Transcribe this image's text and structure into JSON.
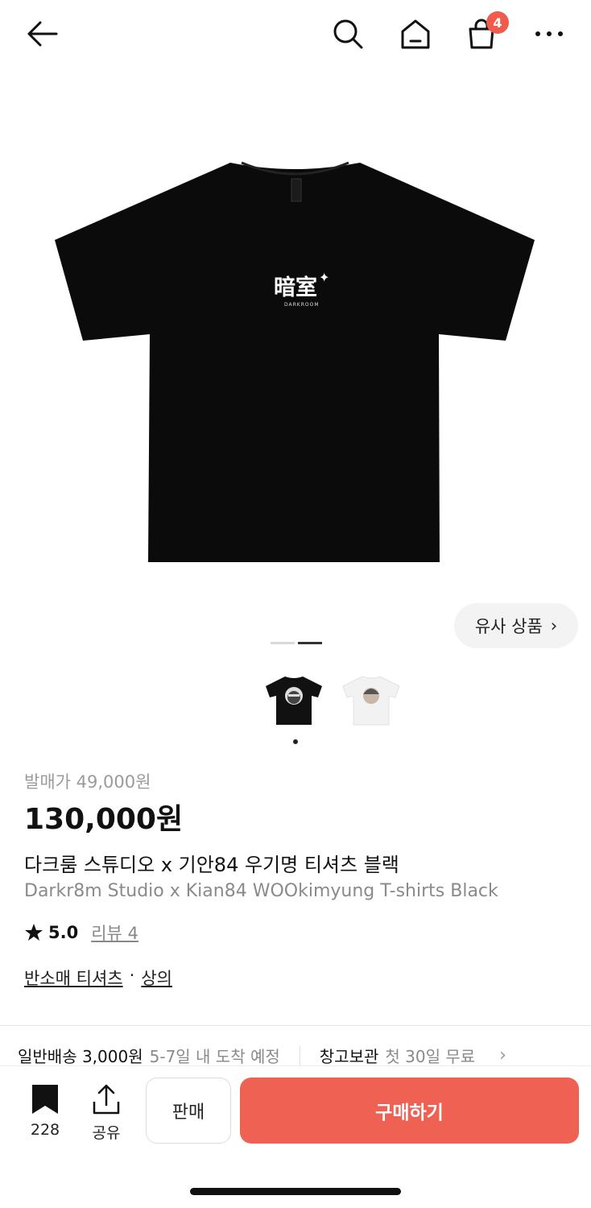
{
  "topbar": {
    "cart_count": "4"
  },
  "hero": {
    "print_hanja": "暗室",
    "print_brand": "DARKROOM"
  },
  "similar": {
    "label": "유사 상품",
    "chevron": "›"
  },
  "product": {
    "orig_price": "발매가 49,000원",
    "price": "130,000원",
    "title_ko": "다크룸 스튜디오 x 기안84 우기명 티셔츠 블랙",
    "title_en": "Darkr8m Studio x Kian84 WOOkimyung T-shirts Black",
    "rating": "5.0",
    "review": "리뷰 4",
    "category_1": "반소매 티셔츠",
    "category_sep": "·",
    "category_2": "상의"
  },
  "delivery": {
    "type": "일반배송 3,000원",
    "eta": "5-7일 내 도착 예정",
    "storage": "창고보관",
    "storage_note": "첫 30일 무료"
  },
  "bottom": {
    "bookmark_count": "228",
    "share_label": "공유",
    "sell_label": "판매",
    "buy_label": "구매하기"
  },
  "colors": {
    "accent": "#ef6253",
    "badge": "#ef5b4c"
  },
  "icons": [
    "back-arrow-icon",
    "search-icon",
    "home-icon",
    "shopping-bag-icon",
    "more-icon",
    "bookmark-icon",
    "share-icon",
    "star-icon",
    "chevron-right-icon"
  ]
}
